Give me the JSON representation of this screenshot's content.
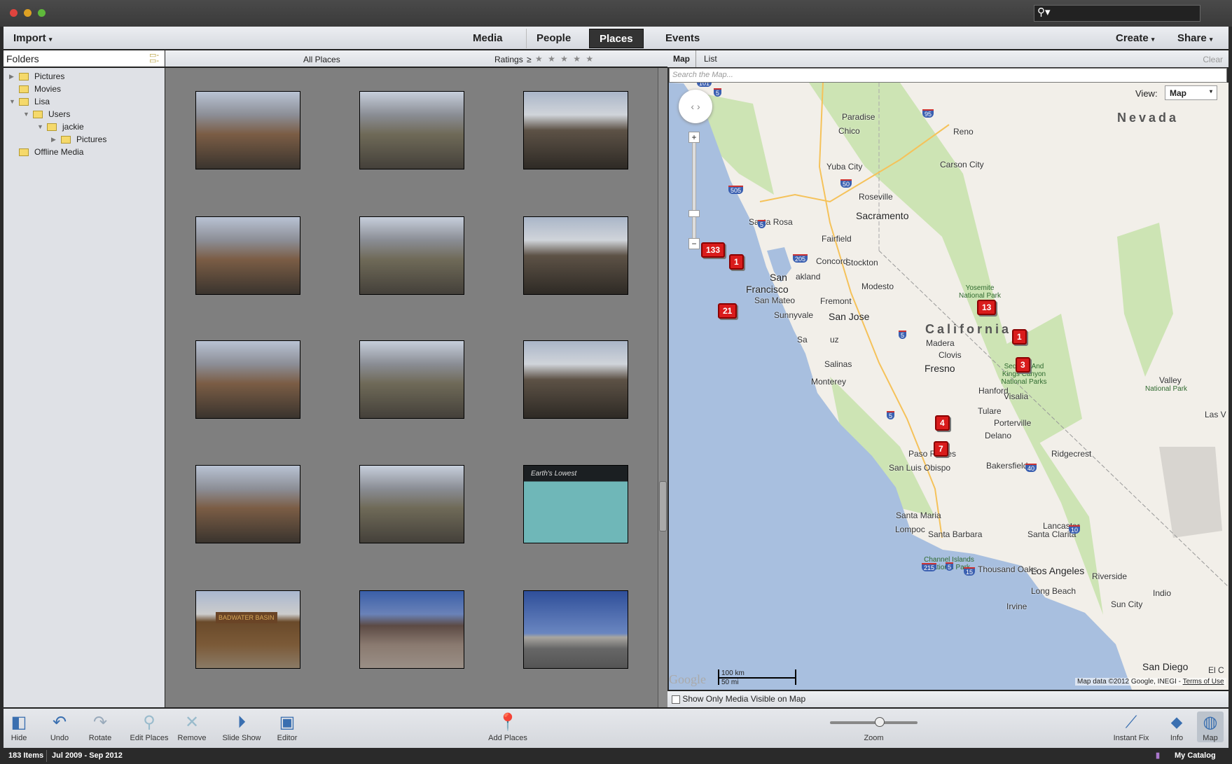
{
  "window": {
    "search_placeholder": ""
  },
  "menubar": {
    "import": "Import",
    "tabs": [
      "Media",
      "People",
      "Places",
      "Events"
    ],
    "active_tab": "Places",
    "create": "Create",
    "share": "Share"
  },
  "folders": {
    "title": "Folders",
    "items": [
      {
        "label": "Pictures",
        "level": 0,
        "expander": "collapsed"
      },
      {
        "label": "Movies",
        "level": 0,
        "expander": "none"
      },
      {
        "label": "Lisa",
        "level": 0,
        "expander": "expanded"
      },
      {
        "label": "Users",
        "level": 1,
        "expander": "expanded"
      },
      {
        "label": "jackie",
        "level": 2,
        "expander": "expanded"
      },
      {
        "label": "Pictures",
        "level": 3,
        "expander": "collapsed"
      },
      {
        "label": "Offline Media",
        "level": 0,
        "expander": "none"
      }
    ]
  },
  "grid": {
    "title": "All Places",
    "ratings_label": "Ratings",
    "ratings_op": "≥",
    "stars": "★ ★ ★ ★ ★",
    "thumb_text": {
      "11": "Earth's Lowest",
      "12": "BADWATER BASIN"
    }
  },
  "map": {
    "tabs": [
      "Map",
      "List"
    ],
    "active_tab": "Map",
    "clear": "Clear",
    "search_placeholder": "Search the Map...",
    "view_label": "View:",
    "view_value": "Map",
    "states": [
      "Nevada",
      "California"
    ],
    "cities": [
      "Paradise",
      "Chico",
      "Reno",
      "Carson City",
      "Yuba City",
      "Roseville",
      "Sacramento",
      "Santa Rosa",
      "Fairfield",
      "Concord",
      "Stockton",
      "San",
      "Francisco",
      "akland",
      "San Mateo",
      "Fremont",
      "Modesto",
      "Sunnyvale",
      "San Jose",
      "Sa",
      "uz",
      "Salinas",
      "Monterey",
      "Madera",
      "Clovis",
      "Fresno",
      "Hanford",
      "Visalia",
      "Tulare",
      "Porterville",
      "Delano",
      "Paso Robles",
      "San Luis Obispo",
      "Bakersfield",
      "Ridgecrest",
      "Santa Maria",
      "Lompoc",
      "Lancaster",
      "Santa Barbara",
      "Santa Clarita",
      "Thousand Oaks",
      "Los Angeles",
      "Riverside",
      "Long Beach",
      "Irvine",
      "Sun City",
      "Indio",
      "San Diego",
      "Las V",
      "Valley",
      "El C"
    ],
    "parks": [
      "Yosemite National Park",
      "Sequoia And Kings Canyon National Parks",
      "National Park",
      "Channel Islands National Park"
    ],
    "highways": [
      "101",
      "5",
      "95",
      "505",
      "50",
      "5",
      "205",
      "5",
      "5",
      "215",
      "40",
      "10",
      "5",
      "15"
    ],
    "markers": [
      "133",
      "1",
      "21",
      "13",
      "1",
      "3",
      "4",
      "7"
    ],
    "scale_km": "100 km",
    "scale_mi": "50 mi",
    "logo": "Google",
    "attribution": "Map data ©2012 Google, INEGI -",
    "terms": "Terms of Use",
    "show_only_label": "Show Only Media Visible on Map",
    "show_only_checked": false,
    "colors": {
      "water": "#a8bfdf",
      "land": "#f2efe9",
      "park": "#cde4b4",
      "marker": "#d91c1c"
    }
  },
  "toolbar": {
    "hide": "Hide",
    "undo": "Undo",
    "rotate": "Rotate",
    "edit_places": "Edit Places",
    "remove": "Remove",
    "slideshow": "Slide Show",
    "editor": "Editor",
    "add_places": "Add Places",
    "zoom": "Zoom",
    "zoom_level": 0.58,
    "instant_fix": "Instant Fix",
    "info": "Info",
    "map": "Map"
  },
  "status": {
    "items": "183 Items",
    "range": "Jul 2009 - Sep 2012",
    "catalog": "My Catalog"
  }
}
